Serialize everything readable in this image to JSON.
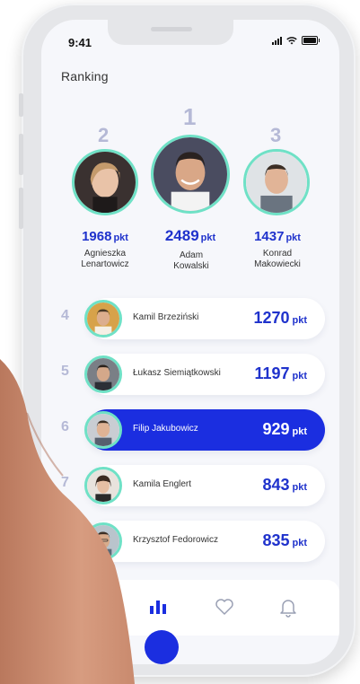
{
  "status": {
    "time": "9:41"
  },
  "header": {
    "title": "Ranking"
  },
  "podium": [
    {
      "rank": "2",
      "score": "1968",
      "unit": "pkt",
      "first": "Agnieszka",
      "last": "Lenartowicz"
    },
    {
      "rank": "1",
      "score": "2489",
      "unit": "pkt",
      "first": "Adam",
      "last": "Kowalski"
    },
    {
      "rank": "3",
      "score": "1437",
      "unit": "pkt",
      "first": "Konrad",
      "last": "Makowiecki"
    }
  ],
  "list": [
    {
      "rank": "4",
      "name": "Kamil Brzeziński",
      "score": "1270",
      "unit": "pkt"
    },
    {
      "rank": "5",
      "name": "Łukasz Siemiątkowski",
      "score": "1197",
      "unit": "pkt"
    },
    {
      "rank": "6",
      "name": "Filip Jakubowicz",
      "score": "929",
      "unit": "pkt"
    },
    {
      "rank": "7",
      "name": "Kamila Englert",
      "score": "843",
      "unit": "pkt"
    },
    {
      "rank": "",
      "name": "Krzysztof Fedorowicz",
      "score": "835",
      "unit": "pkt"
    }
  ],
  "tabs": {
    "icons": [
      "bar-chart-icon",
      "heart-icon",
      "bell-icon"
    ],
    "active": "bar-chart-icon"
  },
  "colors": {
    "accent": "#1b2ee0",
    "score": "#1f32cc",
    "ring": "#6fe1c6",
    "rank_muted": "#b5b9d6"
  }
}
